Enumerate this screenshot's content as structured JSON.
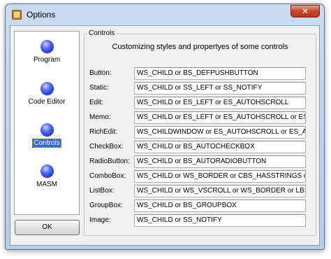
{
  "window": {
    "title": "Options",
    "close_symbol": "✕"
  },
  "sidebar": {
    "items": [
      {
        "label": "Program",
        "icon": "blue-orb-icon",
        "selected": false
      },
      {
        "label": "Code Editor",
        "icon": "blue-orb-icon",
        "selected": false
      },
      {
        "label": "Controls",
        "icon": "blue-orb-icon",
        "selected": true
      },
      {
        "label": "MASM",
        "icon": "blue-orb-icon",
        "selected": false
      }
    ]
  },
  "ok_button": {
    "label": "OK"
  },
  "controls_group": {
    "legend": "Controls",
    "description": "Customizing styles and propertyes of some controls",
    "rows": [
      {
        "label": "Button:",
        "value": "WS_CHILD or BS_DEFPUSHBUTTON"
      },
      {
        "label": "Static:",
        "value": "WS_CHILD or SS_LEFT or SS_NOTIFY"
      },
      {
        "label": "Edit:",
        "value": "WS_CHILD or ES_LEFT or ES_AUTOHSCROLL"
      },
      {
        "label": "Memo:",
        "value": "WS_CHILD or ES_LEFT or ES_AUTOHSCROLL or ES_AUTOV"
      },
      {
        "label": "RichEdit:",
        "value": "WS_CHILDWINDOW or ES_AUTOHSCROLL or ES_AUTOVS"
      },
      {
        "label": "CheckBox:",
        "value": "WS_CHILD or BS_AUTOCHECKBOX"
      },
      {
        "label": "RadioButton:",
        "value": "WS_CHILD or BS_AUTORADIOBUTTON"
      },
      {
        "label": "ComboBox:",
        "value": "WS_CHILD or WS_BORDER or CBS_HASSTRINGS or CBS_D"
      },
      {
        "label": "ListBox:",
        "value": "WS_CHILD or WS_VSCROLL or WS_BORDER or LBS_HASST"
      },
      {
        "label": "GroupBox:",
        "value": "WS_CHILD or BS_GROUPBOX"
      },
      {
        "label": "Image:",
        "value": "WS_CHILD or SS_NOTIFY"
      }
    ]
  },
  "colors": {
    "selection": "#3369d6",
    "orb": "#1e35c9",
    "close": "#c4452a"
  }
}
